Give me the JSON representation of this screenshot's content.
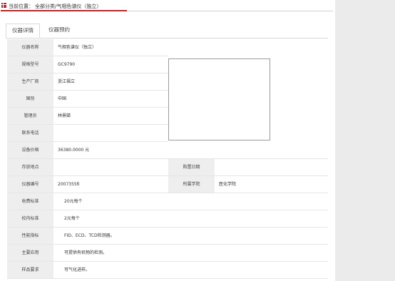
{
  "breadcrumb": {
    "label": "当前位置：",
    "path": "全部分类/气相色谱仪（独立）"
  },
  "tabs": [
    {
      "label": "仪器详情",
      "active": true
    },
    {
      "label": "仪器预约",
      "active": false
    }
  ],
  "fields": {
    "name": {
      "label": "仪器名称",
      "value": "气相色谱仪（独立）"
    },
    "model": {
      "label": "规格型号",
      "value": "GC9790"
    },
    "maker": {
      "label": "生产厂商",
      "value": "浙江福立"
    },
    "country": {
      "label": "国别",
      "value": "中国"
    },
    "manager": {
      "label": "管理员",
      "value": "林景娣"
    },
    "contact": {
      "label": "联系电话",
      "value": ""
    },
    "price": {
      "label": "设备价格",
      "value": "36380.0000 元"
    },
    "location": {
      "label": "存放地点",
      "value": ""
    },
    "purchase_date": {
      "label": "购置日期",
      "value": ""
    },
    "number": {
      "label": "仪器编号",
      "value": "2007355б"
    },
    "college": {
      "label": "所属学院",
      "value": "医化学院"
    },
    "fee_external": {
      "label": "收费标准",
      "value": "20元每个"
    },
    "fee_internal": {
      "label": "校内标准",
      "value": "2元每个"
    },
    "performance": {
      "label": "性能指标",
      "value": "FID、ECD、TCD检测器。"
    },
    "usage": {
      "label": "主要应用",
      "value": "可提供有机物的检测。"
    },
    "sample": {
      "label": "样品要求",
      "value": "可气化进样。"
    }
  },
  "colors": {
    "accent": "#b3282d",
    "label_bg": "#eeeeee",
    "side_panel": "#ebebeb"
  }
}
